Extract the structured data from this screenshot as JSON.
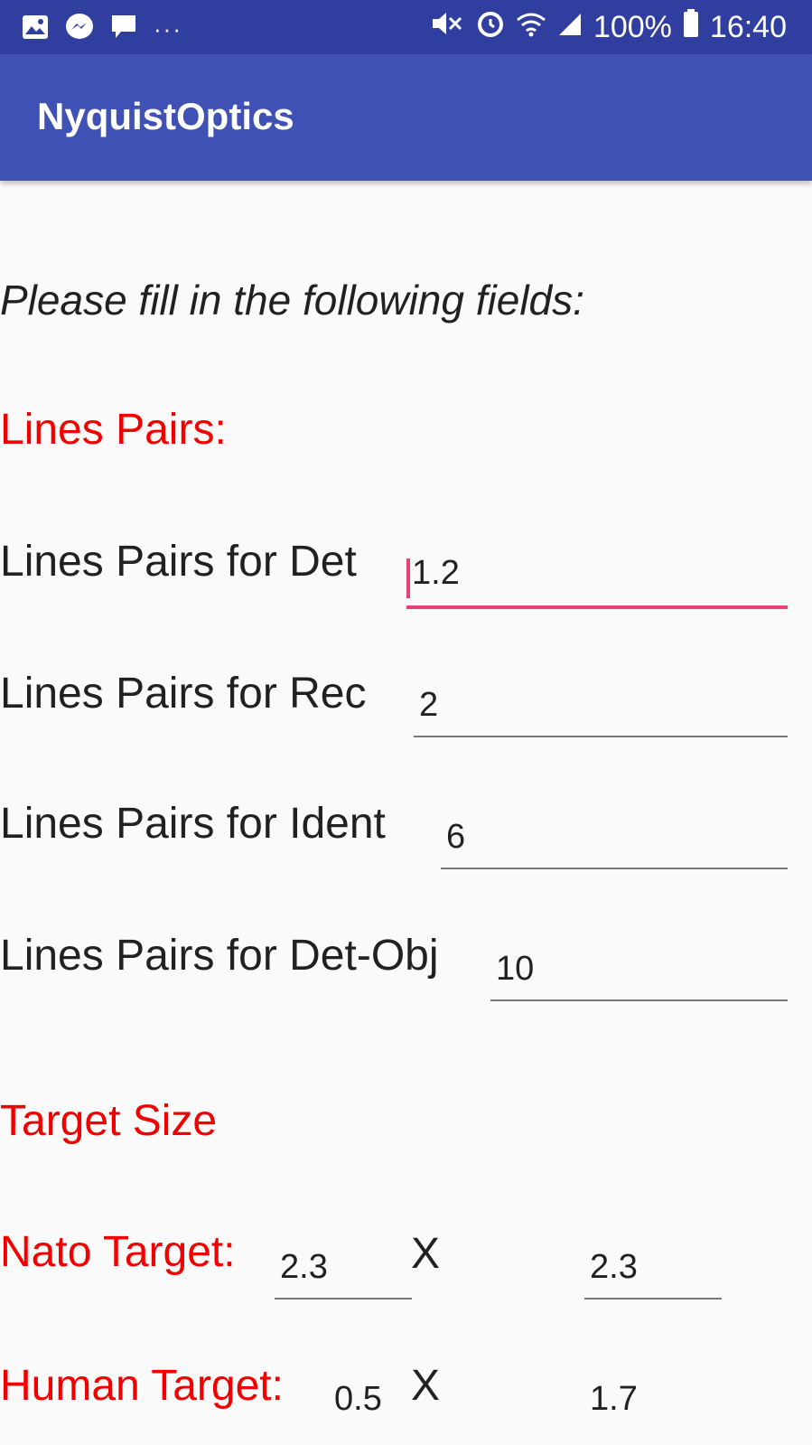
{
  "status_bar": {
    "overflow": "···",
    "battery": "100%",
    "time": "16:40",
    "icons_left": [
      "gallery-icon",
      "messenger-icon",
      "chat-icon"
    ],
    "icons_right": [
      "mute-icon",
      "alarm-icon",
      "wifi-icon",
      "signal-icon",
      "battery-icon"
    ]
  },
  "app_bar": {
    "title": "NyquistOptics"
  },
  "form": {
    "instruction": "Please fill in the following fields:",
    "line_pairs_header": "Lines Pairs:",
    "fields": [
      {
        "label": "Lines Pairs for Det",
        "value": "1.2",
        "focused": true
      },
      {
        "label": "Lines Pairs for Rec",
        "value": "2"
      },
      {
        "label": "Lines Pairs for Ident",
        "value": "6"
      },
      {
        "label": "Lines Pairs for Det-Obj",
        "value": "10"
      }
    ],
    "target_size_header": "Target Size",
    "nato": {
      "label": "Nato Target:",
      "width": "2.3",
      "times": "X",
      "height": "2.3"
    },
    "human": {
      "label": "Human Target:",
      "width": "0.5",
      "times": "X",
      "height": "1.7"
    }
  },
  "colors": {
    "status_bar": "#303f9f",
    "app_bar": "#3f51b5",
    "accent": "#e8407a",
    "section_red": "#f20000"
  }
}
